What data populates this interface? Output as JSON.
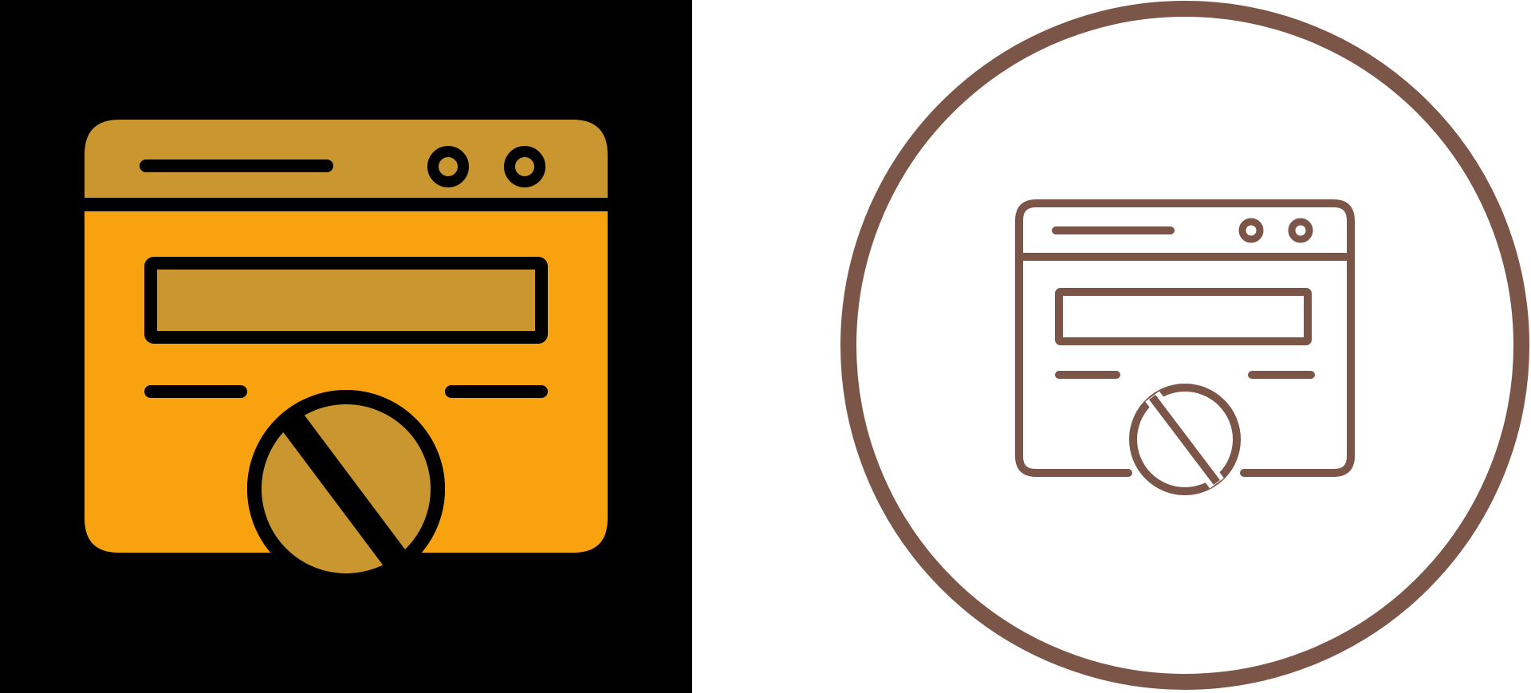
{
  "icons": [
    {
      "name": "blocked-website-icon",
      "style": "glyph-filled",
      "colors": {
        "background": "#000000",
        "frame": "#F9A20F",
        "header": "#C9962F",
        "stroke": "#000000"
      }
    },
    {
      "name": "blocked-website-icon",
      "style": "line",
      "colors": {
        "background": "#FFFFFF",
        "ring": "#7B5547",
        "stroke": "#7B5547"
      }
    }
  ]
}
